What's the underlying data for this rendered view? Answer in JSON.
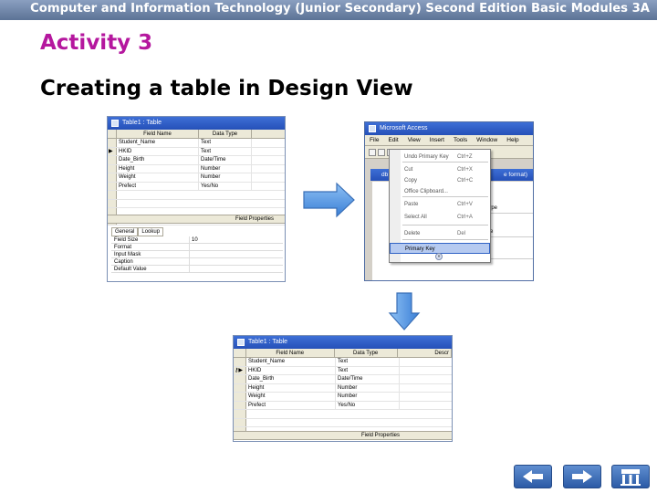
{
  "header": {
    "banner": "Computer and Information Technology (Junior Secondary) Second Edition Basic Modules 3A"
  },
  "slide": {
    "activity": "Activity 3",
    "subtitle": "Creating a table in Design View"
  },
  "window1": {
    "title": "Table1 : Table",
    "columns": [
      "Field Name",
      "Data Type"
    ],
    "rows": [
      {
        "sel": "",
        "name": "Student_Name",
        "type": "Text"
      },
      {
        "sel": "▶",
        "name": "HKID",
        "type": "Text"
      },
      {
        "sel": "",
        "name": "Date_Birth",
        "type": "Date/Time"
      },
      {
        "sel": "",
        "name": "Height",
        "type": "Number"
      },
      {
        "sel": "",
        "name": "Weight",
        "type": "Number"
      },
      {
        "sel": "",
        "name": "Prefect",
        "type": "Yes/No"
      }
    ],
    "field_properties": "Field Properties",
    "tabs": [
      "General",
      "Lookup"
    ],
    "props": [
      {
        "k": "Field Size",
        "v": "10"
      },
      {
        "k": "Format",
        "v": ""
      },
      {
        "k": "Input Mask",
        "v": ""
      },
      {
        "k": "Caption",
        "v": ""
      },
      {
        "k": "Default Value",
        "v": ""
      }
    ]
  },
  "window2": {
    "title": "Microsoft Access",
    "menu": [
      "File",
      "Edit",
      "View",
      "Insert",
      "Tools",
      "Window",
      "Help"
    ],
    "inner_title": "db",
    "inner_suffix": "e format)",
    "type_head": "Type",
    "cell_text": "me",
    "dropdown": [
      {
        "label": "Undo Primary Key",
        "key": "Ctrl+Z"
      },
      {
        "label": "Cut",
        "key": "Ctrl+X"
      },
      {
        "label": "Copy",
        "key": "Ctrl+C"
      },
      {
        "label": "Office Clipboard...",
        "key": ""
      },
      {
        "label": "Paste",
        "key": "Ctrl+V"
      },
      {
        "label": "Select All",
        "key": "Ctrl+A"
      },
      {
        "label": "Delete",
        "key": "Del"
      },
      {
        "label": "Primary Key",
        "key": ""
      }
    ]
  },
  "window3": {
    "title": "Table1 : Table",
    "columns": [
      "Field Name",
      "Data Type",
      "Descr"
    ],
    "rows": [
      {
        "sel": "",
        "name": "Student_Name",
        "type": "Text"
      },
      {
        "sel": "⚷▶",
        "name": "HKID",
        "type": "Text"
      },
      {
        "sel": "",
        "name": "Date_Birth",
        "type": "Date/Time"
      },
      {
        "sel": "",
        "name": "Height",
        "type": "Number"
      },
      {
        "sel": "",
        "name": "Weight",
        "type": "Number"
      },
      {
        "sel": "",
        "name": "Prefect",
        "type": "Yes/No"
      }
    ],
    "field_properties": "Field Properties"
  },
  "icons": {
    "right_arrow": "right-arrow-icon",
    "down_arrow": "down-arrow-icon",
    "prev": "left-arrow-icon",
    "next": "right-arrow-icon",
    "home": "home-icon"
  },
  "colors": {
    "accent": "#b5179e",
    "arrow": "#4a8fe0",
    "title_bar": "#2a5bc4"
  }
}
